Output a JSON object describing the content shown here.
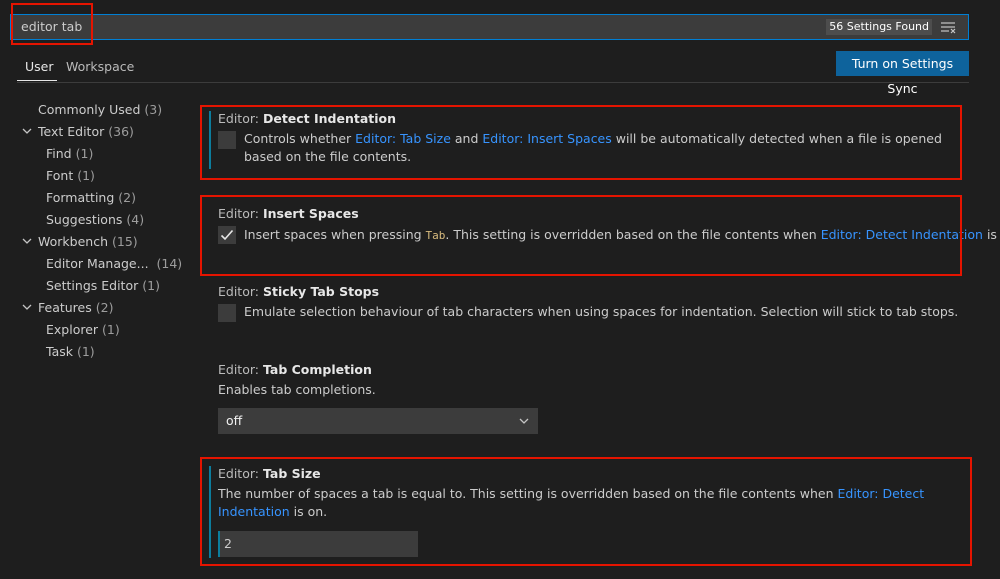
{
  "search": {
    "value": "editor tab",
    "results_badge": "56 Settings Found"
  },
  "tabs": [
    {
      "label": "User"
    },
    {
      "label": "Workspace"
    }
  ],
  "sync_button": "Turn on Settings Sync",
  "toc": [
    {
      "label": "Commonly Used",
      "count": "(3)"
    },
    {
      "label": "Text Editor",
      "count": "(36)"
    },
    {
      "label": "Find",
      "count": "(1)"
    },
    {
      "label": "Font",
      "count": "(1)"
    },
    {
      "label": "Formatting",
      "count": "(2)"
    },
    {
      "label": "Suggestions",
      "count": "(4)"
    },
    {
      "label": "Workbench",
      "count": "(15)"
    },
    {
      "label": "Editor Manage...",
      "count": "(14)"
    },
    {
      "label": "Settings Editor",
      "count": "(1)"
    },
    {
      "label": "Features",
      "count": "(2)"
    },
    {
      "label": "Explorer",
      "count": "(1)"
    },
    {
      "label": "Task",
      "count": "(1)"
    }
  ],
  "settings": {
    "detect_indentation": {
      "category": "Editor: ",
      "name": "Detect Indentation",
      "desc_1": "Controls whether ",
      "link_1": "Editor: Tab Size",
      "desc_2": " and ",
      "link_2": "Editor: Insert Spaces",
      "desc_3": " will be automatically detected when a file is opened based on the file contents.",
      "checked": false
    },
    "insert_spaces": {
      "category": "Editor: ",
      "name": "Insert Spaces",
      "desc_1": "Insert spaces when pressing ",
      "code": "Tab",
      "desc_2": ". This setting is overridden based on the file contents when ",
      "link_1": "Editor: Detect Indentation",
      "desc_3": " is on.",
      "checked": true
    },
    "sticky_tab_stops": {
      "category": "Editor: ",
      "name": "Sticky Tab Stops",
      "desc": "Emulate selection behaviour of tab characters when using spaces for indentation. Selection will stick to tab stops.",
      "checked": false
    },
    "tab_completion": {
      "category": "Editor: ",
      "name": "Tab Completion",
      "desc": "Enables tab completions.",
      "value": "off"
    },
    "tab_size": {
      "category": "Editor: ",
      "name": "Tab Size",
      "desc_1": "The number of spaces a tab is equal to. This setting is overridden based on the file contents when ",
      "link_1": "Editor: Detect Indentation",
      "desc_2": " is on.",
      "value": "2"
    }
  },
  "colors": {
    "highlight_border": "#e51400",
    "link": "#3794ff",
    "accent": "#0e639c",
    "modified": "#0c7d9d"
  }
}
